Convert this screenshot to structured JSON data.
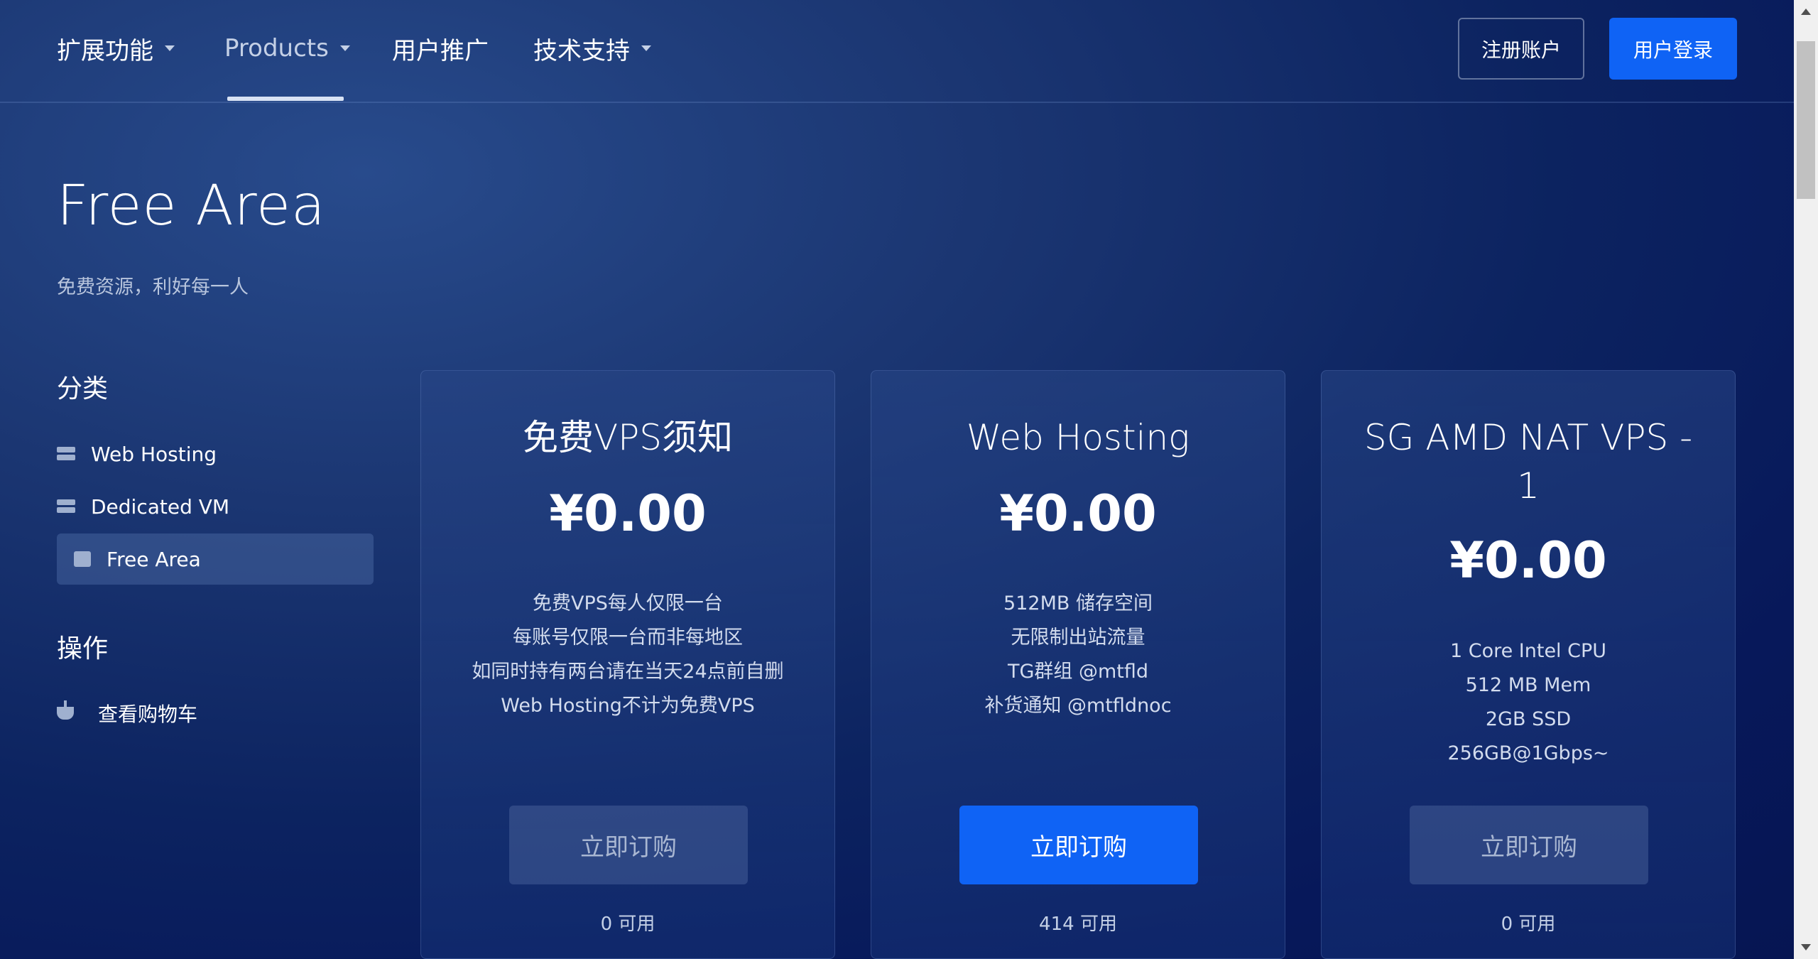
{
  "nav": {
    "items": [
      {
        "label": "扩展功能",
        "has_dropdown": true
      },
      {
        "label": "Products",
        "has_dropdown": true,
        "active": true
      },
      {
        "label": "用户推广",
        "has_dropdown": false
      },
      {
        "label": "技术支持",
        "has_dropdown": true
      }
    ],
    "register_label": "注册账户",
    "login_label": "用户登录"
  },
  "header": {
    "title": "Free Area",
    "subtitle": "免费资源，利好每一人"
  },
  "sidebar": {
    "categories_heading": "分类",
    "categories": [
      {
        "label": "Web Hosting",
        "icon": "server-icon"
      },
      {
        "label": "Dedicated VM",
        "icon": "server-icon"
      },
      {
        "label": "Free Area",
        "icon": "box-icon",
        "active": true
      }
    ],
    "actions_heading": "操作",
    "actions": [
      {
        "label": "查看购物车",
        "icon": "cart-icon"
      }
    ]
  },
  "products": [
    {
      "title": "免费VPS须知",
      "price": "¥0.00",
      "features": [
        "免费VPS每人仅限一台",
        "每账号仅限一台而非每地区",
        "如同时持有两台请在当天24点前自删",
        "Web Hosting不计为免费VPS"
      ],
      "button_label": "立即订购",
      "availability": "0 可用"
    },
    {
      "title": "Web Hosting",
      "price": "¥0.00",
      "features": [
        "512MB 储存空间",
        "无限制出站流量",
        "TG群组 @mtfld",
        "补货通知 @mtfldnoc"
      ],
      "button_label": "立即订购",
      "availability": "414 可用"
    },
    {
      "title": "SG AMD NAT VPS - 1",
      "price": "¥0.00",
      "features": [
        "1 Core Intel CPU",
        "512 MB Mem",
        "2GB SSD",
        "256GB@1Gbps~"
      ],
      "button_label": "立即订购",
      "availability": "0 可用"
    }
  ],
  "colors": {
    "primary_button": "#0f63f5",
    "background_dark": "#061552",
    "background_light": "#284b8c"
  }
}
